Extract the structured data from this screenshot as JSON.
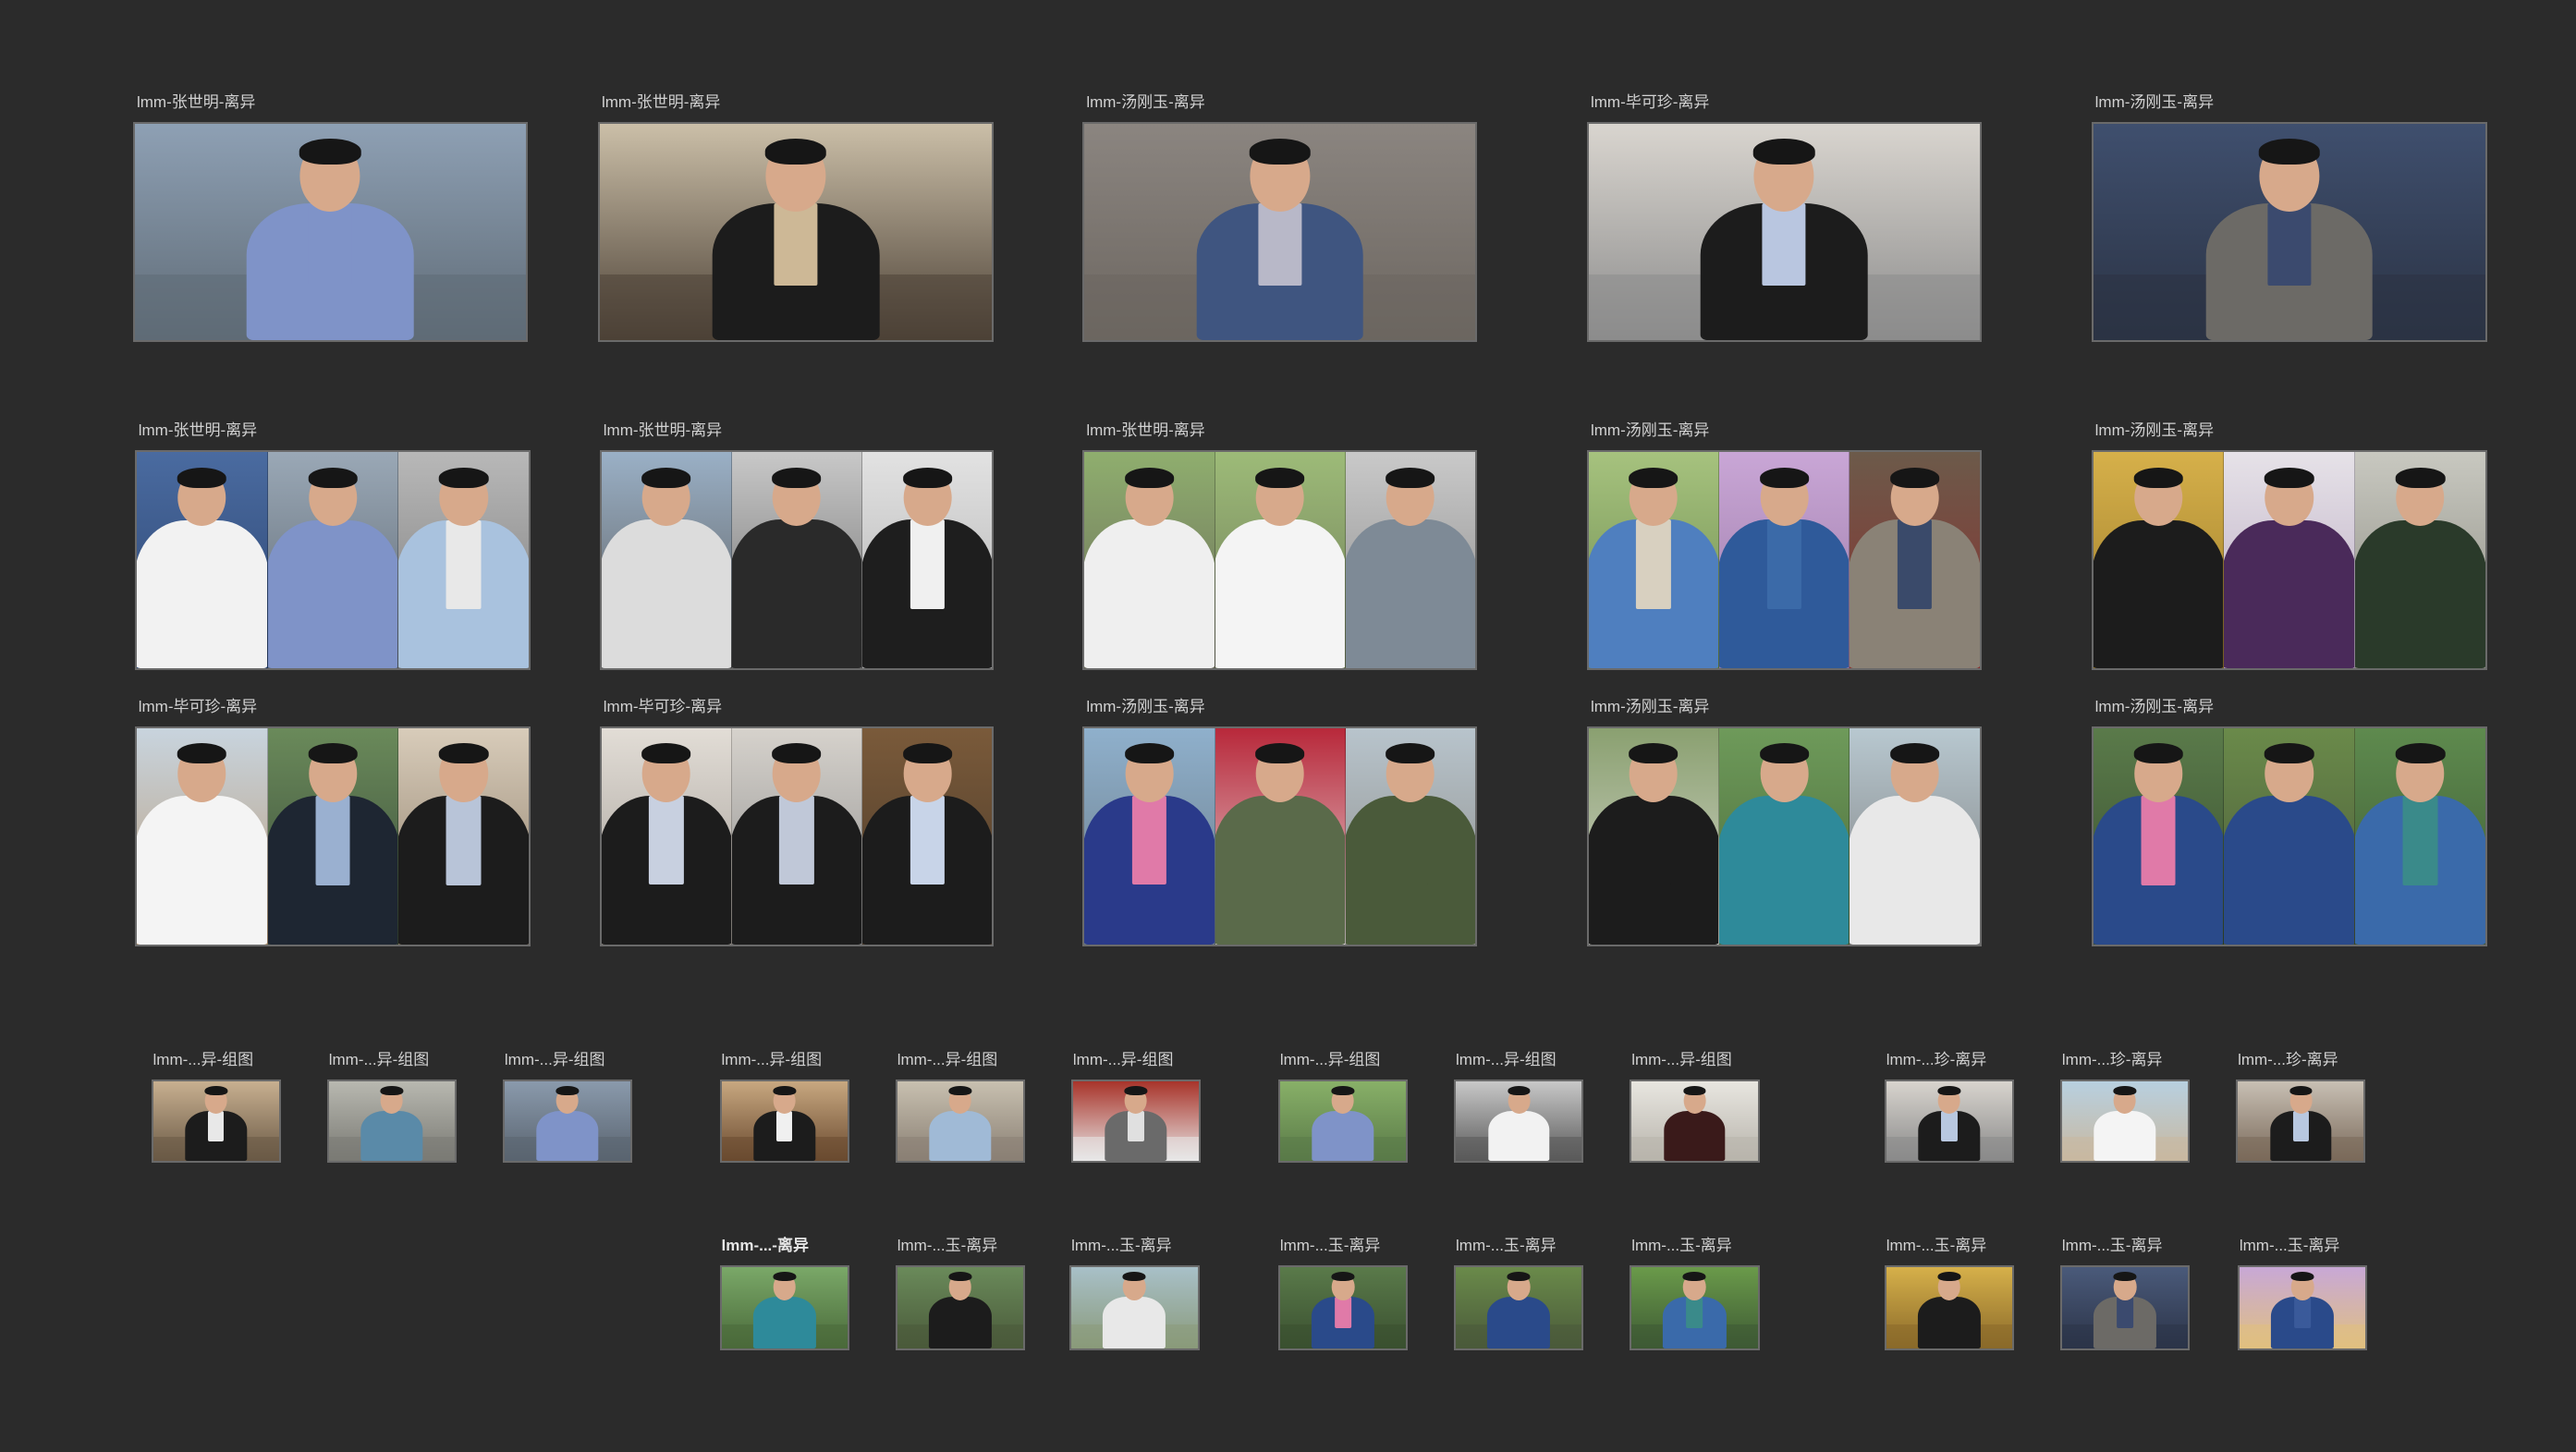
{
  "frames": [
    {
      "label": "lmm-张世明-离异",
      "photos": [
        {
          "bg": "#8ea0b4",
          "bg2": "#5f6b76",
          "suit": "#7f93c8",
          "shirt": "#7f93c8"
        }
      ]
    },
    {
      "label": "lmm-张世明-离异",
      "photos": [
        {
          "bg": "#cbbfa8",
          "bg2": "#4c4136",
          "suit": "#1c1c1c",
          "shirt": "#cdb896"
        }
      ]
    },
    {
      "label": "lmm-汤刚玉-离异",
      "photos": [
        {
          "bg": "#8b8580",
          "bg2": "#6c6660",
          "suit": "#3f5580",
          "shirt": "#b8b8c8"
        }
      ]
    },
    {
      "label": "lmm-毕可珍-离异",
      "photos": [
        {
          "bg": "#d9d5cf",
          "bg2": "#8c8c8c",
          "suit": "#1c1c1c",
          "shirt": "#b9c6e0"
        }
      ]
    },
    {
      "label": "lmm-汤刚玉-离异",
      "photos": [
        {
          "bg": "#3f4f6e",
          "bg2": "#2b3344",
          "suit": "#6c6a66",
          "shirt": "#3b4a6e"
        }
      ]
    },
    {
      "label": "lmm-张世明-离异",
      "photos": [
        {
          "bg": "#4a6ba0",
          "bg2": "#2c4470",
          "suit": "#f2f2f2",
          "shirt": "#f2f2f2"
        },
        {
          "bg": "#9aa8b6",
          "bg2": "#5c6670",
          "suit": "#7f93c8",
          "shirt": "#7f93c8"
        },
        {
          "bg": "#b8b8b8",
          "bg2": "#7a7a7a",
          "suit": "#a9c2de",
          "shirt": "#e8e8e8"
        }
      ]
    },
    {
      "label": "lmm-张世明-离异",
      "photos": [
        {
          "bg": "#9ab0c6",
          "bg2": "#5a5a5a",
          "suit": "#dcdcdc",
          "shirt": "#dcdcdc"
        },
        {
          "bg": "#c8c8c8",
          "bg2": "#6a6a6a",
          "suit": "#2a2a2a",
          "shirt": "#2a2a2a"
        },
        {
          "bg": "#e2e2e2",
          "bg2": "#b0b0b0",
          "suit": "#1e1e1e",
          "shirt": "#f0f0f0"
        }
      ]
    },
    {
      "label": "lmm-张世明-离异",
      "photos": [
        {
          "bg": "#8fae6e",
          "bg2": "#6a6a5a",
          "suit": "#efefef",
          "shirt": "#efefef"
        },
        {
          "bg": "#9dbb78",
          "bg2": "#6e7a58",
          "suit": "#f4f4f4",
          "shirt": "#f4f4f4"
        },
        {
          "bg": "#c9c9c9",
          "bg2": "#8a8a8a",
          "suit": "#7e8a96",
          "shirt": "#7e8a96"
        }
      ]
    },
    {
      "label": "lmm-汤刚玉-离异",
      "photos": [
        {
          "bg": "#a6c27e",
          "bg2": "#6c8a4e",
          "suit": "#4f7fbf",
          "shirt": "#d8d0c0"
        },
        {
          "bg": "#c9a6d6",
          "bg2": "#9a7aa6",
          "suit": "#2f5a9a",
          "shirt": "#3b6aa8"
        },
        {
          "bg": "#6c5a4a",
          "bg2": "#8a3030",
          "suit": "#8a8276",
          "shirt": "#3a4a6a"
        }
      ]
    },
    {
      "label": "lmm-汤刚玉-离异",
      "photos": [
        {
          "bg": "#d6b04a",
          "bg2": "#9a7a2a",
          "suit": "#1c1c1c",
          "shirt": "#1c1c1c"
        },
        {
          "bg": "#e6e2e8",
          "bg2": "#b8a8c0",
          "suit": "#4a2a5a",
          "shirt": "#4a2a5a"
        },
        {
          "bg": "#c8c8c0",
          "bg2": "#8a8a80",
          "suit": "#2a3a2a",
          "shirt": "#2a3a2a"
        }
      ]
    },
    {
      "label": "lmm-毕可珍-离异",
      "photos": [
        {
          "bg": "#c8d4de",
          "bg2": "#b89a78",
          "suit": "#f4f4f4",
          "shirt": "#f4f4f4"
        },
        {
          "bg": "#6a8a5a",
          "bg2": "#3a4a3a",
          "suit": "#1e2632",
          "shirt": "#9ab0d0"
        },
        {
          "bg": "#d8ccba",
          "bg2": "#8a7a66",
          "suit": "#1c1c1c",
          "shirt": "#b8c4d8"
        }
      ]
    },
    {
      "label": "lmm-毕可珍-离异",
      "photos": [
        {
          "bg": "#e2ddd6",
          "bg2": "#a09a94",
          "suit": "#1c1c1c",
          "shirt": "#c8d0e0"
        },
        {
          "bg": "#d6d2cc",
          "bg2": "#8a8a8a",
          "suit": "#1c1c1c",
          "shirt": "#c0c8d8"
        },
        {
          "bg": "#7a5a3a",
          "bg2": "#4a3a2a",
          "suit": "#1c1c1c",
          "shirt": "#c8d4e8"
        }
      ]
    },
    {
      "label": "lmm-汤刚玉-离异",
      "photos": [
        {
          "bg": "#8fb0cc",
          "bg2": "#6a7a86",
          "suit": "#2a3a8a",
          "shirt": "#e07aa8"
        },
        {
          "bg": "#b8283a",
          "bg2": "#e8e0e0",
          "suit": "#5a6a4a",
          "shirt": "#5a6a4a"
        },
        {
          "bg": "#b8c4cc",
          "bg2": "#8a8a86",
          "suit": "#4a5a3a",
          "shirt": "#4a5a3a"
        }
      ]
    },
    {
      "label": "lmm-汤刚玉-离异",
      "photos": [
        {
          "bg": "#8aa070",
          "bg2": "#d8d8d0",
          "suit": "#1c1c1c",
          "shirt": "#1c1c1c"
        },
        {
          "bg": "#6e9a5a",
          "bg2": "#4a6a3a",
          "suit": "#2e8a9a",
          "shirt": "#2e8a9a"
        },
        {
          "bg": "#b8c8d0",
          "bg2": "#7a7a7a",
          "suit": "#e8e8e8",
          "shirt": "#e8e8e8"
        }
      ]
    },
    {
      "label": "lmm-汤刚玉-离异",
      "photos": [
        {
          "bg": "#5a7a4a",
          "bg2": "#3a5030",
          "suit": "#2a4a8a",
          "shirt": "#e07aa8"
        },
        {
          "bg": "#6a8a4a",
          "bg2": "#4a5a3a",
          "suit": "#2a4a8a",
          "shirt": "#2a4a8a"
        },
        {
          "bg": "#5e8a4e",
          "bg2": "#3e5a34",
          "suit": "#3a6aaa",
          "shirt": "#3a8a8a"
        }
      ]
    },
    {
      "label": "lmm-...异-组图",
      "photos": [
        {
          "bg": "#c8b090",
          "bg2": "#6a5a46",
          "suit": "#1c1c1c",
          "shirt": "#e8e8e8"
        }
      ]
    },
    {
      "label": "lmm-...异-组图",
      "photos": [
        {
          "bg": "#b8b8b0",
          "bg2": "#7a7a74",
          "suit": "#5a8aa8",
          "shirt": "#5a8aa8"
        }
      ]
    },
    {
      "label": "lmm-...异-组图",
      "photos": [
        {
          "bg": "#8a9aac",
          "bg2": "#5a6470",
          "suit": "#7f93c8",
          "shirt": "#7f93c8"
        }
      ]
    },
    {
      "label": "lmm-...异-组图",
      "photos": [
        {
          "bg": "#c8a880",
          "bg2": "#6a4a30",
          "suit": "#1c1c1c",
          "shirt": "#f0f0f0"
        }
      ]
    },
    {
      "label": "lmm-...异-组图",
      "photos": [
        {
          "bg": "#c8c0b0",
          "bg2": "#8a8074",
          "suit": "#a0bad6",
          "shirt": "#a0bad6"
        }
      ]
    },
    {
      "label": "lmm-...异-组图",
      "photos": [
        {
          "bg": "#a8342a",
          "bg2": "#e8e8e8",
          "suit": "#6a6a6a",
          "shirt": "#e0e0e0"
        }
      ]
    },
    {
      "label": "lmm-...异-组图",
      "photos": [
        {
          "bg": "#88b068",
          "bg2": "#5a7a48",
          "suit": "#7f93c8",
          "shirt": "#7f93c8"
        }
      ]
    },
    {
      "label": "lmm-...异-组图",
      "photos": [
        {
          "bg": "#c8c8c8",
          "bg2": "#5a5a5a",
          "suit": "#f2f2f2",
          "shirt": "#f2f2f2"
        }
      ]
    },
    {
      "label": "lmm-...异-组图",
      "photos": [
        {
          "bg": "#e8e6e0",
          "bg2": "#b8b4ac",
          "suit": "#3a1a1a",
          "shirt": "#3a1a1a"
        }
      ]
    },
    {
      "label": "lmm-...珍-离异",
      "photos": [
        {
          "bg": "#d8d4ce",
          "bg2": "#8a8a8a",
          "suit": "#1c1c1c",
          "shirt": "#b8c8e0"
        }
      ]
    },
    {
      "label": "lmm-...珍-离异",
      "photos": [
        {
          "bg": "#b8d0e0",
          "bg2": "#c8b8a0",
          "suit": "#f4f4f4",
          "shirt": "#f4f4f4"
        }
      ]
    },
    {
      "label": "lmm-...珍-离异",
      "photos": [
        {
          "bg": "#c8c0b4",
          "bg2": "#7a6a5a",
          "suit": "#1c1c1c",
          "shirt": "#b8c8e0"
        }
      ]
    },
    {
      "label": "lmm-...-离异",
      "bold": true,
      "photos": [
        {
          "bg": "#7aa868",
          "bg2": "#4a6a3a",
          "suit": "#2e8a9a",
          "shirt": "#2e8a9a"
        }
      ]
    },
    {
      "label": "lmm-...玉-离异",
      "photos": [
        {
          "bg": "#6a8a5a",
          "bg2": "#4a5a3a",
          "suit": "#1c1c1c",
          "shirt": "#1c1c1c"
        }
      ]
    },
    {
      "label": "lmm-...玉-离异",
      "photos": [
        {
          "bg": "#a8c0c8",
          "bg2": "#8a9a7a",
          "suit": "#e8e8e8",
          "shirt": "#e8e8e8"
        }
      ]
    },
    {
      "label": "lmm-...玉-离异",
      "photos": [
        {
          "bg": "#5a7a4a",
          "bg2": "#3a5030",
          "suit": "#2a4a8a",
          "shirt": "#e07aa8"
        }
      ]
    },
    {
      "label": "lmm-...玉-离异",
      "photos": [
        {
          "bg": "#6a8a4a",
          "bg2": "#4a5a3a",
          "suit": "#2a4a8a",
          "shirt": "#2a4a8a"
        }
      ]
    },
    {
      "label": "lmm-...玉-离异",
      "photos": [
        {
          "bg": "#6a9a4a",
          "bg2": "#3e5a34",
          "suit": "#3a6aaa",
          "shirt": "#3a8a8a"
        }
      ]
    },
    {
      "label": "lmm-...玉-离异",
      "photos": [
        {
          "bg": "#d6b04a",
          "bg2": "#8a6a2a",
          "suit": "#1c1c1c",
          "shirt": "#1c1c1c"
        }
      ]
    },
    {
      "label": "lmm-...玉-离异",
      "photos": [
        {
          "bg": "#4a5a7a",
          "bg2": "#2c3448",
          "suit": "#6c6a66",
          "shirt": "#3b4a6e"
        }
      ]
    },
    {
      "label": "lmm-...玉-离异",
      "photos": [
        {
          "bg": "#c8a8d6",
          "bg2": "#e0c080",
          "suit": "#2a4a8a",
          "shirt": "#3a5a9a"
        }
      ]
    }
  ]
}
